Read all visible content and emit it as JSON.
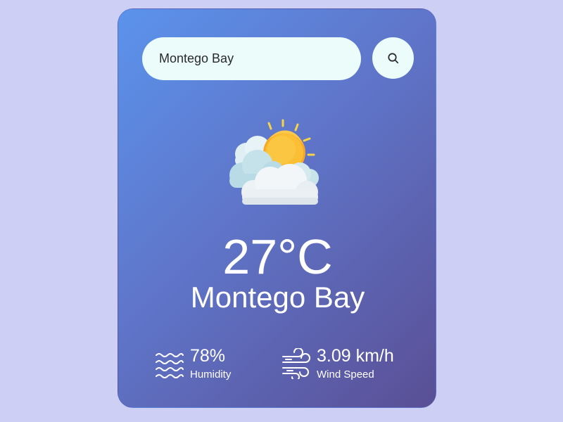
{
  "search": {
    "value": "Montego Bay",
    "button_icon": "search-icon"
  },
  "weather": {
    "icon": "partly-cloudy-icon",
    "temperature": "27°C",
    "city": "Montego Bay"
  },
  "stats": {
    "humidity": {
      "icon": "humidity-waves-icon",
      "value": "78%",
      "label": "Humidity"
    },
    "wind": {
      "icon": "wind-icon",
      "value": "3.09 km/h",
      "label": "Wind Speed"
    }
  },
  "colors": {
    "background": "#cdd0f4",
    "card_gradient_start": "#5b93ec",
    "card_gradient_end": "#5a4f95",
    "input_background": "#ebfcfb",
    "text": "#ffffff"
  }
}
